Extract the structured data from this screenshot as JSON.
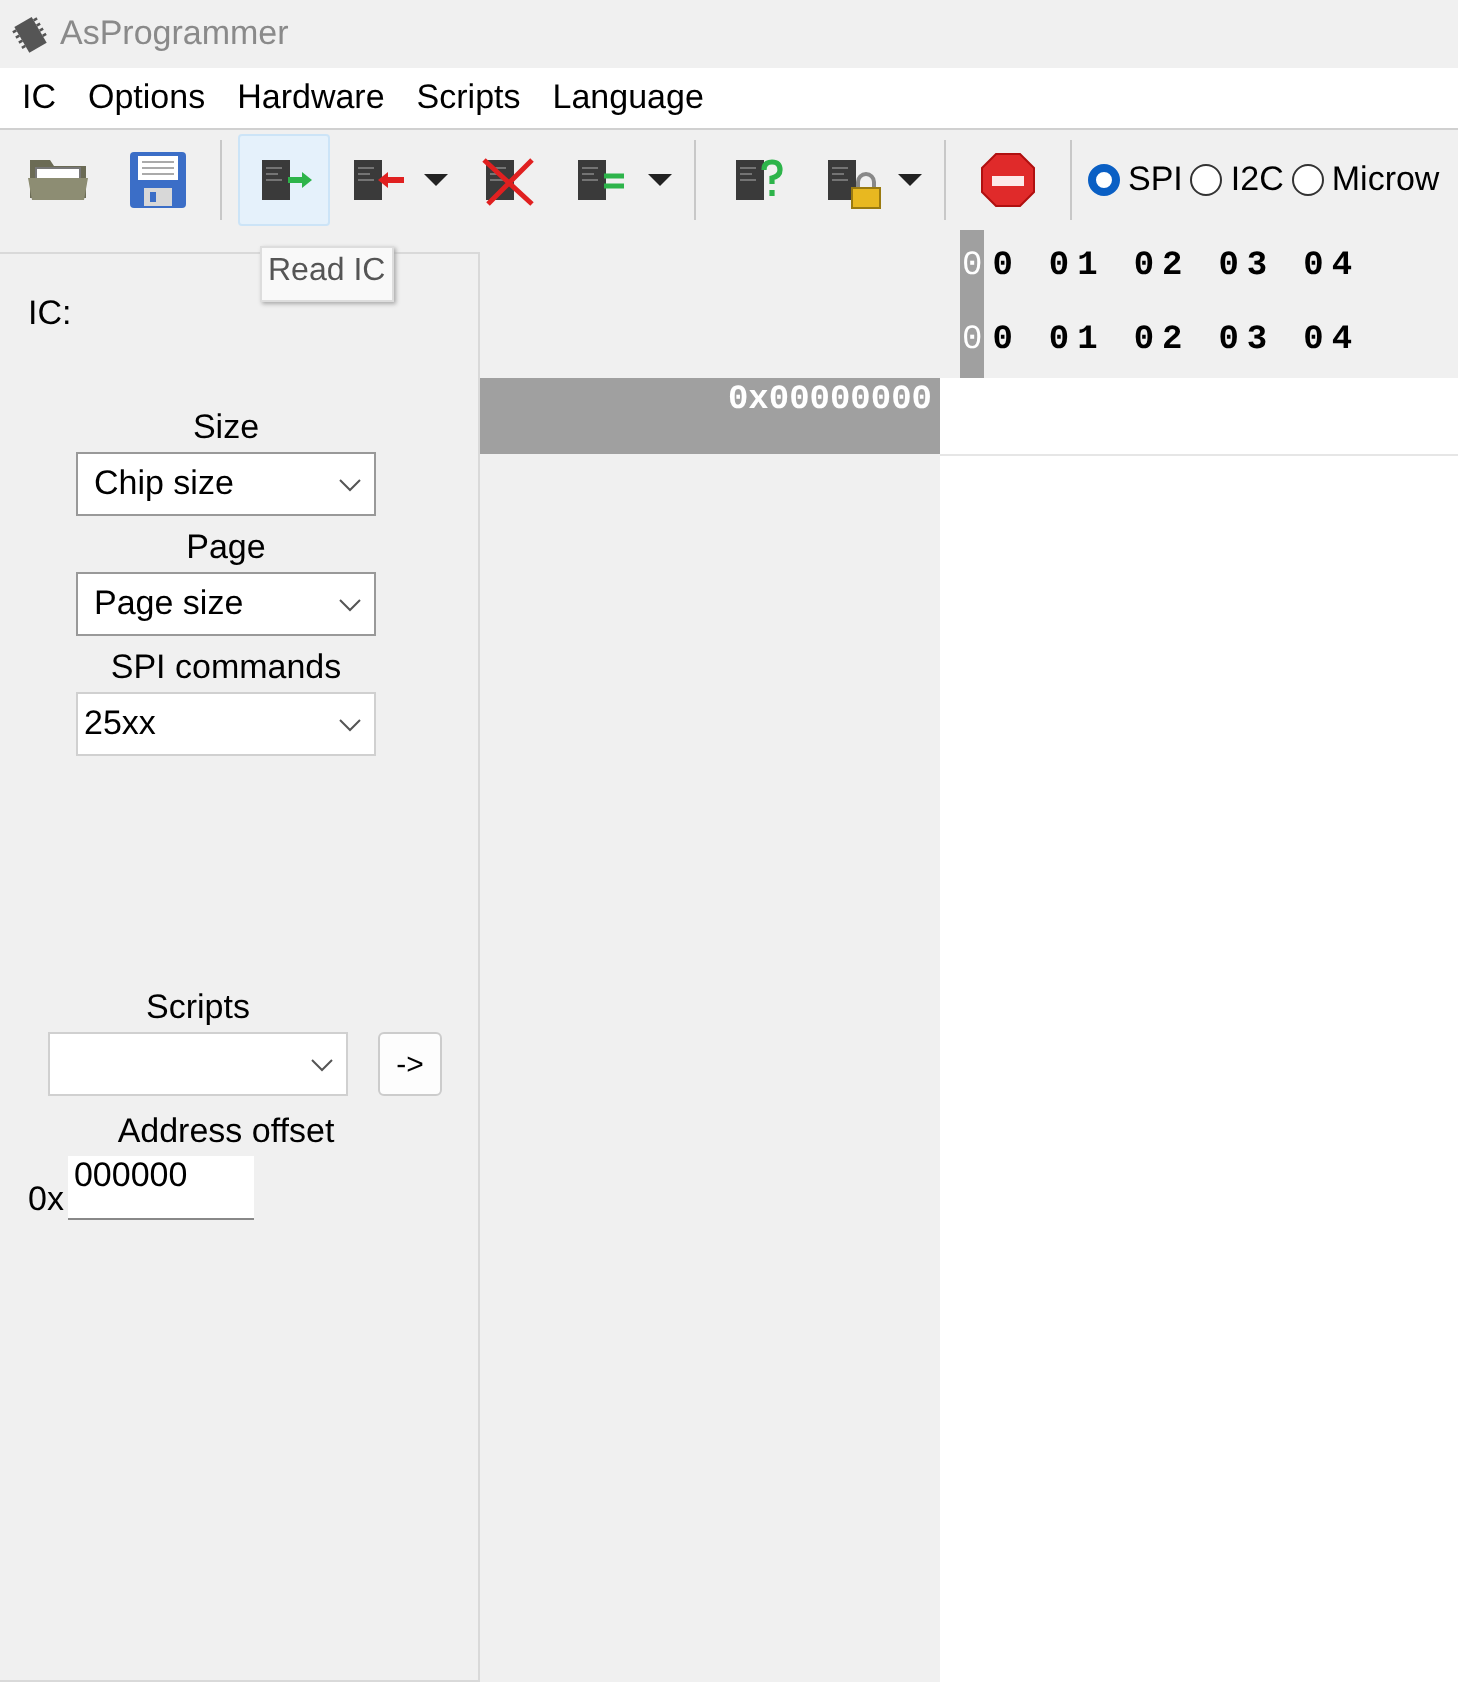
{
  "window": {
    "title": "AsProgrammer"
  },
  "menu": [
    "IC",
    "Options",
    "Hardware",
    "Scripts",
    "Language"
  ],
  "toolbar": [
    {
      "kind": "button",
      "hovered": false,
      "dropdown": false
    },
    {
      "kind": "button",
      "hovered": false,
      "dropdown": false
    },
    {
      "kind": "separator"
    },
    {
      "kind": "button",
      "hovered": true,
      "dropdown": false
    },
    {
      "kind": "button",
      "hovered": false,
      "dropdown": true
    },
    {
      "kind": "button",
      "hovered": false,
      "dropdown": false
    },
    {
      "kind": "button",
      "hovered": false,
      "dropdown": true
    },
    {
      "kind": "separator"
    },
    {
      "kind": "button",
      "hovered": false,
      "dropdown": false
    },
    {
      "kind": "button",
      "hovered": false,
      "dropdown": true
    },
    {
      "kind": "separator"
    },
    {
      "kind": "button",
      "hovered": false,
      "dropdown": false
    },
    {
      "kind": "separator"
    }
  ],
  "interfaces": [
    {
      "label": "SPI",
      "selected": true
    },
    {
      "label": "I2C",
      "selected": false
    },
    {
      "label": "Microw",
      "selected": false
    }
  ],
  "tooltip": {
    "text": "Read IC"
  },
  "panel": {
    "ic_label": "IC:",
    "size": {
      "label": "Size",
      "value": "Chip size"
    },
    "page": {
      "label": "Page",
      "value": "Page size"
    },
    "spi_commands": {
      "label": "SPI commands",
      "value": "25xx"
    },
    "scripts": {
      "label": "Scripts",
      "button": "->"
    },
    "address_offset": {
      "label": "Address offset",
      "prefix": "0x",
      "value": "000000"
    }
  },
  "hex": {
    "header_rows": [
      {
        "cursor": "0",
        "cells": [
          "0",
          "01",
          "02",
          "03",
          "04"
        ]
      },
      {
        "cursor": "0",
        "cells": [
          "0",
          "01",
          "02",
          "03",
          "04"
        ]
      }
    ],
    "address": "0x00000000"
  }
}
